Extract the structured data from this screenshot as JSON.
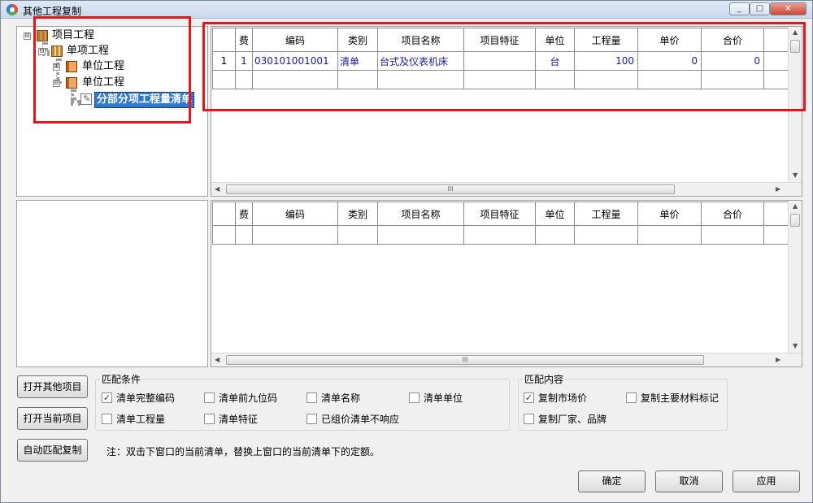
{
  "window": {
    "title": "其他工程复制",
    "controls": [
      "_",
      "□",
      "×"
    ]
  },
  "tree": {
    "nodes": [
      {
        "label": "项目工程",
        "icon": "project-folder-icon",
        "expander": "⊟"
      },
      {
        "label": "单项工程",
        "icon": "single-project-icon",
        "expander": "⊟"
      },
      {
        "label": "单位工程",
        "icon": "unit-project-icon",
        "expander": "⊞"
      },
      {
        "label": "单位工程",
        "icon": "unit-project-icon",
        "expander": "⊟"
      },
      {
        "label": "分部分项工程量清单",
        "icon": "bill-list-icon",
        "selected": true
      }
    ]
  },
  "upper_grid": {
    "columns": [
      "",
      "费",
      "编码",
      "类别",
      "项目名称",
      "项目特征",
      "单位",
      "工程量",
      "单价",
      "合价"
    ],
    "rows": [
      {
        "row": "1",
        "fee": "1",
        "code": "030101001001",
        "category": "清单",
        "name": "台式及仪表机床",
        "feature": "",
        "unit": "台",
        "quantity": "100",
        "price": "0",
        "total": "0"
      }
    ],
    "hscroll_label": "III"
  },
  "lower_grid": {
    "columns": [
      "",
      "费",
      "编码",
      "类别",
      "项目名称",
      "项目特征",
      "单位",
      "工程量",
      "单价",
      "合价"
    ],
    "hscroll_label": "III"
  },
  "buttons": {
    "open_other": "打开其他项目",
    "open_current": "打开当前项目",
    "auto_match": "自动匹配复制",
    "ok": "确定",
    "cancel": "取消",
    "apply": "应用"
  },
  "match_conditions": {
    "title": "匹配条件",
    "options": [
      {
        "label": "清单完整编码",
        "checked": true
      },
      {
        "label": "清单前九位码",
        "checked": false
      },
      {
        "label": "清单名称",
        "checked": false
      },
      {
        "label": "清单单位",
        "checked": false
      },
      {
        "label": "清单工程量",
        "checked": false
      },
      {
        "label": "清单特征",
        "checked": false
      },
      {
        "label": "已组价清单不响应",
        "checked": false
      }
    ]
  },
  "match_content": {
    "title": "匹配内容",
    "options": [
      {
        "label": "复制市场价",
        "checked": true
      },
      {
        "label": "复制主要材料标记",
        "checked": false
      },
      {
        "label": "复制厂家、品牌",
        "checked": false
      }
    ]
  },
  "note": "注：双击下窗口的当前清单，替换上窗口的当前清单下的定额。",
  "colors": {
    "highlight_red": "#e8141b",
    "selection_blue": "#3078d0",
    "cell_text": "#1a1aa8"
  }
}
